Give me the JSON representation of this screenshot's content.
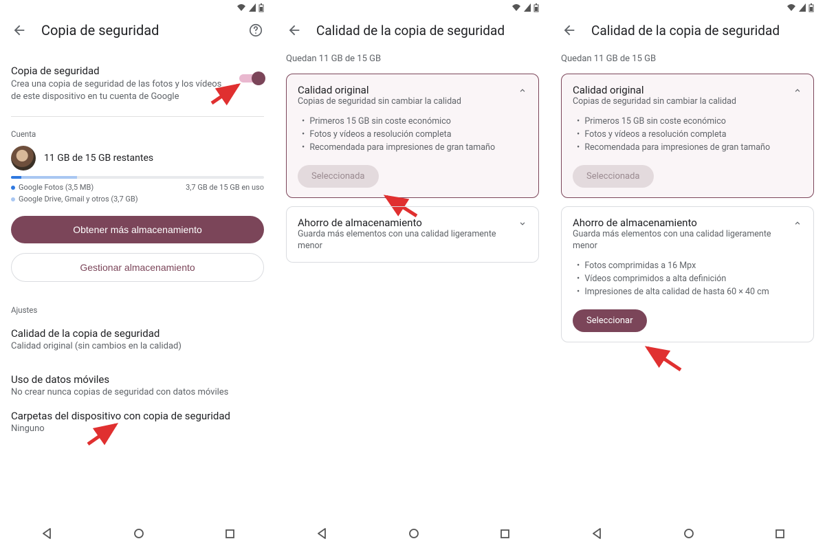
{
  "statusbar": {
    "wifi": "▾",
    "signal": "▲",
    "battery": "▮"
  },
  "panel1": {
    "title": "Copia de seguridad",
    "backup": {
      "title": "Copia de seguridad",
      "sub": "Crea una copia de seguridad de las fotos y los vídeos de este dispositivo en tu cuenta de Google"
    },
    "account_label": "Cuenta",
    "storage_remaining": "11 GB de 15 GB restantes",
    "bar_seg1_pct": "4",
    "bar_seg2_pct": "22",
    "legend": {
      "item1": "Google Fotos (3,5 MB)",
      "item2": "Google Drive, Gmail y otros (3,7 GB)",
      "usage": "3,7 GB de 15 GB en uso"
    },
    "btn_get_more": "Obtener más almacenamiento",
    "btn_manage": "Gestionar almacenamiento",
    "settings_label": "Ajustes",
    "settings": [
      {
        "t": "Calidad de la copia de seguridad",
        "s": "Calidad original (sin cambios en la calidad)"
      },
      {
        "t": "Uso de datos móviles",
        "s": "No crear nunca copias de seguridad con datos móviles"
      },
      {
        "t": "Carpetas del dispositivo con copia de seguridad",
        "s": "Ninguno"
      }
    ]
  },
  "panel2": {
    "title": "Calidad de la copia de seguridad",
    "quota": "Quedan 11 GB de 15 GB",
    "card_original": {
      "title": "Calidad original",
      "sub": "Copias de seguridad sin cambiar la calidad",
      "bullets": [
        "Primeros 15 GB sin coste económico",
        "Fotos y vídeos a resolución completa",
        "Recomendada para impresiones de gran tamaño"
      ],
      "pill": "Seleccionada"
    },
    "card_saver": {
      "title": "Ahorro de almacenamiento",
      "sub": "Guarda más elementos con una calidad ligeramente menor"
    }
  },
  "panel3": {
    "title": "Calidad de la copia de seguridad",
    "quota": "Quedan 11 GB de 15 GB",
    "card_original": {
      "title": "Calidad original",
      "sub": "Copias de seguridad sin cambiar la calidad",
      "bullets": [
        "Primeros 15 GB sin coste económico",
        "Fotos y vídeos a resolución completa",
        "Recomendada para impresiones de gran tamaño"
      ],
      "pill": "Seleccionada"
    },
    "card_saver": {
      "title": "Ahorro de almacenamiento",
      "sub": "Guarda más elementos con una calidad ligeramente menor",
      "bullets": [
        "Fotos comprimidas a 16 Mpx",
        "Vídeos comprimidos a alta definición",
        "Impresiones de alta calidad de hasta 60 × 40 cm"
      ],
      "pill": "Seleccionar"
    }
  }
}
